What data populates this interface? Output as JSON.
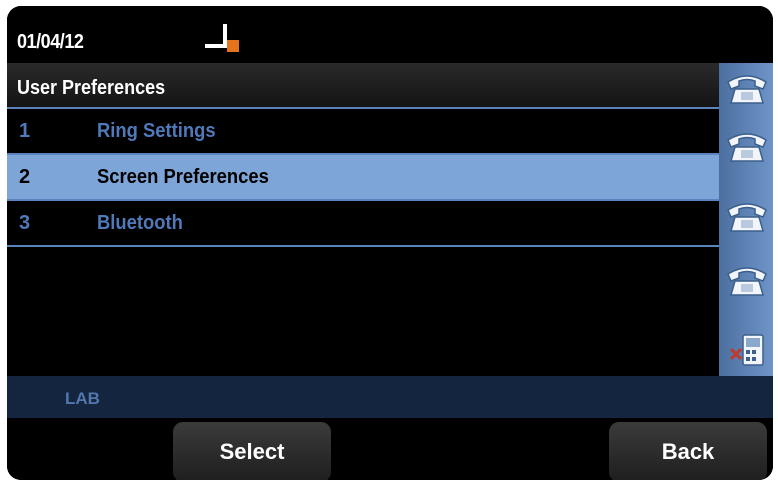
{
  "status": {
    "date": "01/04/12",
    "signal_icon": "network-signal-icon"
  },
  "title": "User Preferences",
  "menu": [
    {
      "number": "1",
      "label": "Ring Settings",
      "selected": false
    },
    {
      "number": "2",
      "label": "Screen Preferences",
      "selected": true
    },
    {
      "number": "3",
      "label": "Bluetooth",
      "selected": false
    }
  ],
  "line_keys": [
    {
      "icon": "phone-handset-icon"
    },
    {
      "icon": "phone-handset-icon"
    },
    {
      "icon": "phone-handset-icon"
    },
    {
      "icon": "phone-handset-icon"
    },
    {
      "icon": "phone-unregistered-icon"
    }
  ],
  "info_bar": {
    "text": "LAB"
  },
  "softkeys": {
    "select_label": "Select",
    "back_label": "Back"
  },
  "colors": {
    "accent": "#5b84bf",
    "selected_row": "#7ea5d8",
    "item_text": "#4f79b9",
    "info_bar_bg": "#14263f"
  }
}
